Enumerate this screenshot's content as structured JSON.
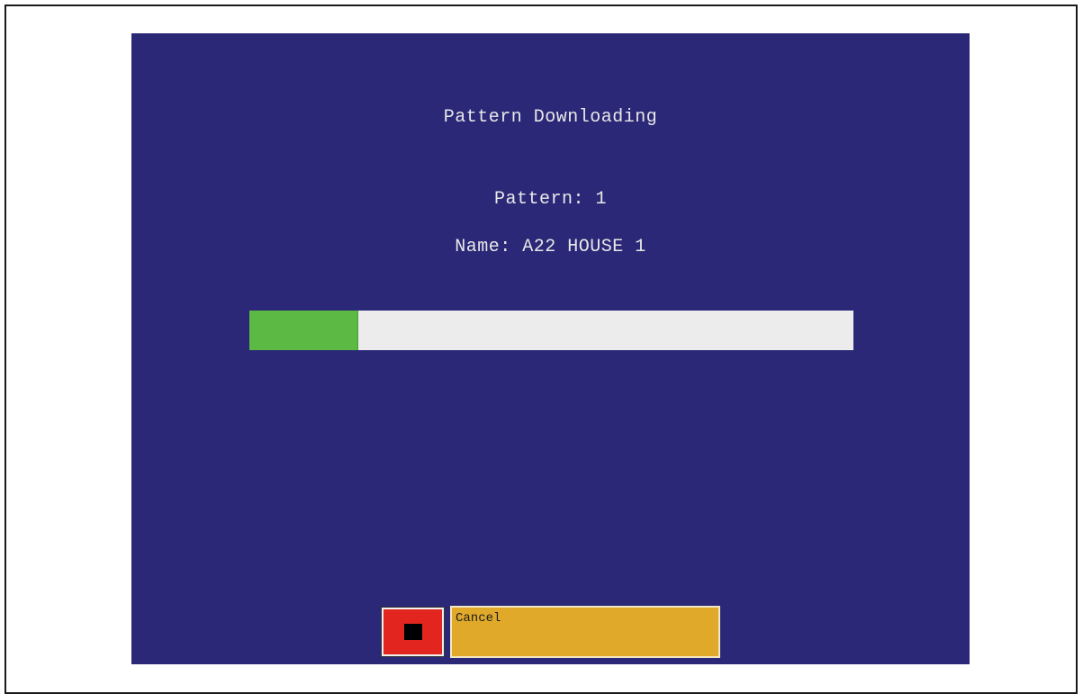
{
  "screen": {
    "title": "Pattern Downloading",
    "pattern_line": "Pattern: 1",
    "name_line": "Name: A22 HOUSE 1"
  },
  "progress": {
    "fraction": 0.18
  },
  "buttons": {
    "stop_icon": "stop-icon",
    "cancel_label": "Cancel"
  },
  "colors": {
    "screen_bg": "#2a2877",
    "progress_fill": "#5cb944",
    "progress_track": "#ececec",
    "stop_button": "#e2261f",
    "cancel_button": "#e0a92a"
  }
}
